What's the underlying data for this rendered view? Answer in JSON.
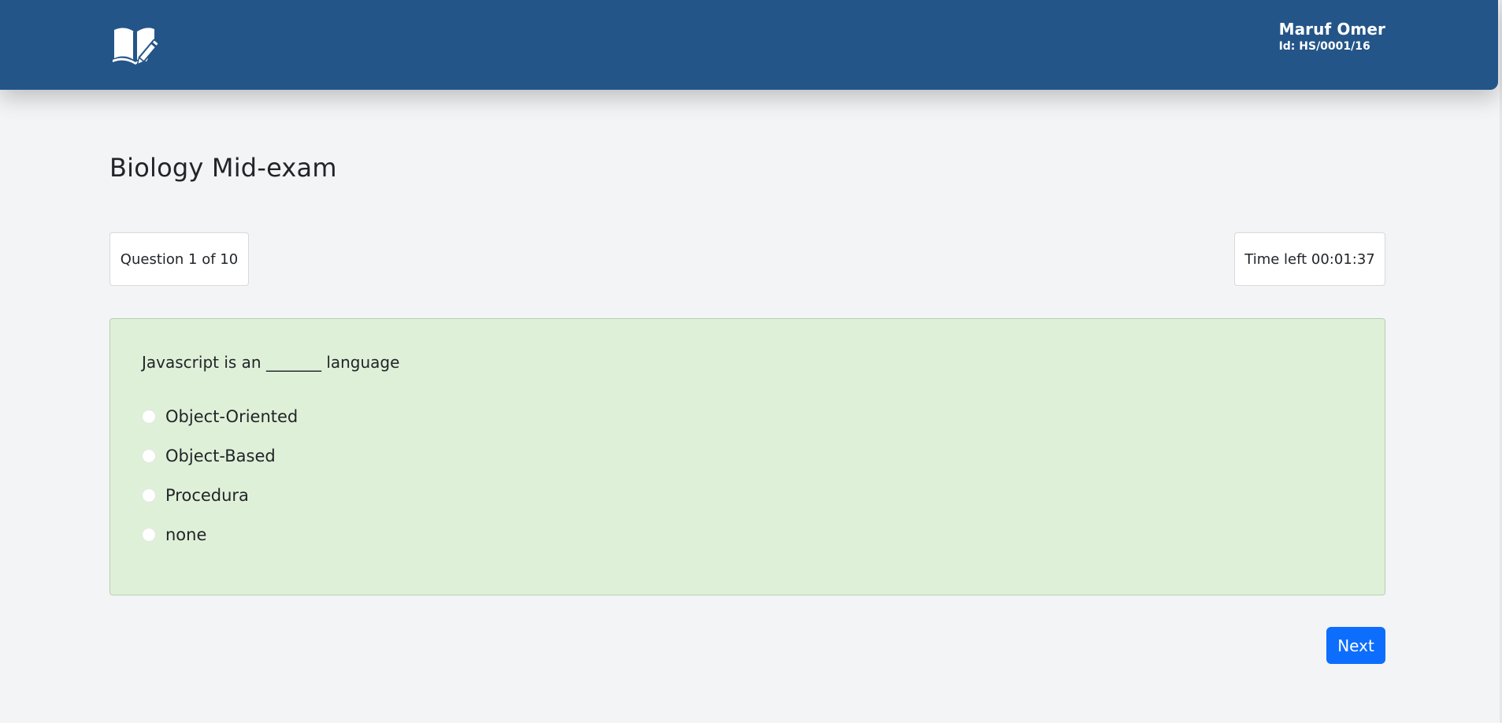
{
  "header": {
    "logo_icon": "book-pen-icon",
    "user_name": "Maruf Omer",
    "user_id": "Id: HS/0001/16",
    "background_color": "#245589"
  },
  "exam": {
    "title": "Biology Mid-exam",
    "question_counter": "Question 1 of 10",
    "time_left": "Time left 00:01:37"
  },
  "question": {
    "text": "Javascript is an _______ language",
    "card_color": "#dff0d8",
    "options": [
      {
        "label": "Object-Oriented",
        "selected": false
      },
      {
        "label": "Object-Based",
        "selected": false
      },
      {
        "label": "Procedura",
        "selected": false
      },
      {
        "label": "none",
        "selected": false
      }
    ]
  },
  "actions": {
    "next_label": "Next",
    "next_color": "#0d6efd"
  }
}
